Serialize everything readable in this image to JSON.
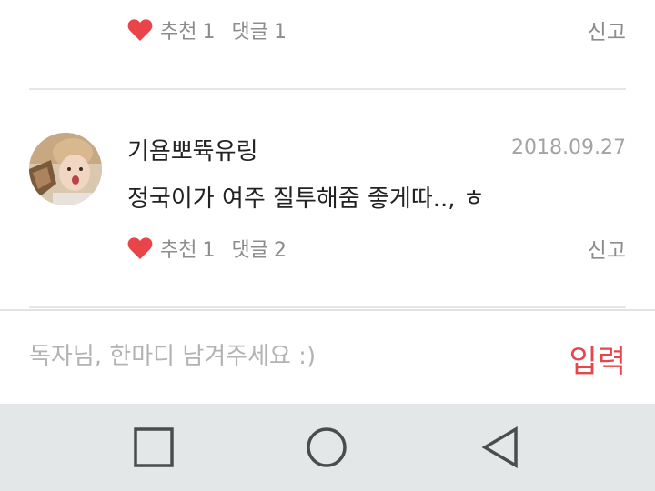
{
  "comments": [
    {
      "like_label": "추천",
      "like_count": "1",
      "reply_label": "댓글",
      "reply_count": "1",
      "report_label": "신고"
    },
    {
      "username": "기욤뽀뜍유링",
      "date": "2018.09.27",
      "text": "정국이가 여주 질투해줌 좋게따.., ㅎ",
      "like_label": "추천",
      "like_count": "1",
      "reply_label": "댓글",
      "reply_count": "2",
      "report_label": "신고"
    }
  ],
  "input": {
    "placeholder": "독자님, 한마디 남겨주세요 :)",
    "value": "",
    "submit_label": "입력"
  },
  "colors": {
    "heart": "#e8444a",
    "submit": "#e8444a",
    "nav_bar": "#e3e7e8",
    "muted_text": "#8c8c8c"
  },
  "icons": {
    "like": "heart-icon",
    "nav_recents": "square-icon",
    "nav_home": "circle-icon",
    "nav_back": "triangle-back-icon"
  }
}
